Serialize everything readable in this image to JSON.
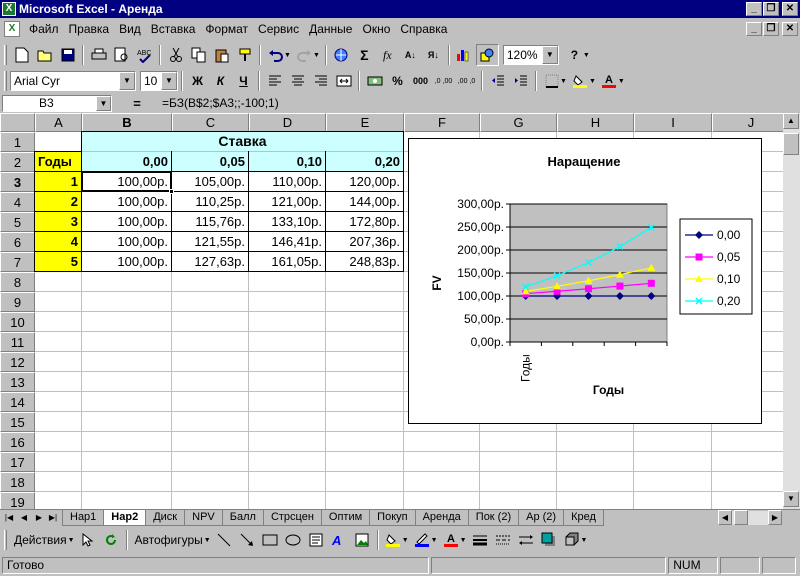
{
  "window": {
    "title": "Microsoft Excel - Аренда",
    "app_icon": "excel-icon",
    "controls": {
      "minimize": "_",
      "restore": "❐",
      "close": "✕"
    }
  },
  "menu": {
    "items": [
      "Файл",
      "Правка",
      "Вид",
      "Вставка",
      "Формат",
      "Сервис",
      "Данные",
      "Окно",
      "Справка"
    ]
  },
  "toolbar_standard": {
    "zoom": "120%",
    "icons": [
      "new-icon",
      "open-icon",
      "save-icon",
      "print-icon",
      "print-preview-icon",
      "spelling-icon",
      "cut-icon",
      "copy-icon",
      "paste-icon",
      "format-painter-icon",
      "undo-icon",
      "redo-icon",
      "hyperlink-icon",
      "autosum-icon",
      "function-icon",
      "sort-ascending-icon",
      "sort-descending-icon",
      "chart-wizard-icon",
      "drawing-icon",
      "help-icon"
    ],
    "glyphs": {
      "autosum": "Σ",
      "function": "fx",
      "sort_az": "А↓",
      "sort_za": "Я↓",
      "help": "?"
    }
  },
  "toolbar_formatting": {
    "font": "Arial Cyr",
    "size": "10",
    "bold": "Ж",
    "italic": "К",
    "underline": "Ч",
    "percent": "%",
    "thousands": "000",
    "inc_decimal": ",0 ,00",
    "dec_decimal": ",00 ,0",
    "fill_color": "#ffff00",
    "font_color": "#ff0000"
  },
  "formula_bar": {
    "name_box": "B3",
    "equals": "=",
    "formula": "=БЗ(B$2;$A3;;-100;1)"
  },
  "sheet": {
    "columns": [
      "A",
      "B",
      "C",
      "D",
      "E",
      "F",
      "G",
      "H",
      "I",
      "J"
    ],
    "active_column": "B",
    "rows": [
      "1",
      "2",
      "3",
      "4",
      "5",
      "6",
      "7",
      "8",
      "9",
      "10",
      "11",
      "12",
      "13",
      "14",
      "15",
      "16",
      "17",
      "18",
      "19"
    ],
    "active_row": "3",
    "header_rate": "Ставка",
    "years_label": "Годы",
    "rates": [
      "0,00",
      "0,05",
      "0,10",
      "0,20"
    ],
    "years": [
      "1",
      "2",
      "3",
      "4",
      "5"
    ],
    "values": [
      [
        "100,00р.",
        "105,00р.",
        "110,00р.",
        "120,00р."
      ],
      [
        "100,00р.",
        "110,25р.",
        "121,00р.",
        "144,00р."
      ],
      [
        "100,00р.",
        "115,76р.",
        "133,10р.",
        "172,80р."
      ],
      [
        "100,00р.",
        "121,55р.",
        "146,41р.",
        "207,36р."
      ],
      [
        "100,00р.",
        "127,63р.",
        "161,05р.",
        "248,83р."
      ]
    ],
    "colors": {
      "yellow": "#ffff00",
      "cyan": "#ccffff",
      "grid": "#c0c0c0"
    }
  },
  "chart_data": {
    "type": "line",
    "title": "Наращение",
    "xlabel": "Годы",
    "ylabel": "FV",
    "x": [
      1,
      2,
      3,
      4,
      5
    ],
    "x_tick_label": "Годы",
    "ylim": [
      0,
      300
    ],
    "yticks": [
      "0,00р.",
      "50,00р.",
      "100,00р.",
      "150,00р.",
      "200,00р.",
      "250,00р.",
      "300,00р."
    ],
    "ytick_values": [
      0,
      50,
      100,
      150,
      200,
      250,
      300
    ],
    "legend": "right",
    "plot_bg": "#c0c0c0",
    "series": [
      {
        "name": "0,00",
        "values": [
          100.0,
          100.0,
          100.0,
          100.0,
          100.0
        ],
        "color": "#000080",
        "marker": "diamond"
      },
      {
        "name": "0,05",
        "values": [
          105.0,
          110.25,
          115.76,
          121.55,
          127.63
        ],
        "color": "#ff00ff",
        "marker": "square"
      },
      {
        "name": "0,10",
        "values": [
          110.0,
          121.0,
          133.1,
          146.41,
          161.05
        ],
        "color": "#ffff00",
        "marker": "triangle"
      },
      {
        "name": "0,20",
        "values": [
          120.0,
          144.0,
          172.8,
          207.36,
          248.83
        ],
        "color": "#00ffff",
        "marker": "x"
      }
    ]
  },
  "sheet_tabs": {
    "tabs": [
      "Нар1",
      "Нар2",
      "Диск",
      "NPV",
      "Балл",
      "Стрсцен",
      "Оптим",
      "Покуп",
      "Аренда",
      "Пок (2)",
      "Ар (2)",
      "Кред"
    ],
    "active": "Нар2"
  },
  "drawing_toolbar": {
    "actions": "Действия",
    "autoshapes": "Автофигуры",
    "icons": [
      "pointer-icon",
      "free-rotate-icon",
      "line-icon",
      "arrow-icon",
      "rectangle-icon",
      "oval-icon",
      "text-box-icon",
      "wordart-icon",
      "fill-color-icon",
      "line-color-icon",
      "font-color-icon",
      "line-style-icon",
      "dash-style-icon",
      "arrow-style-icon",
      "shadow-icon",
      "3d-icon"
    ]
  },
  "status": {
    "text": "Готово",
    "num": "NUM"
  }
}
